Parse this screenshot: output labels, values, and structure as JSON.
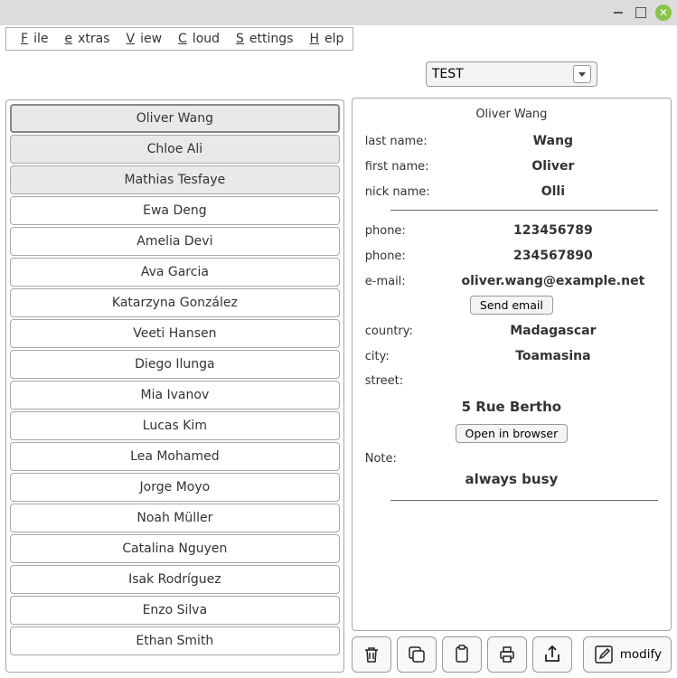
{
  "menu": {
    "file": "File",
    "extras": "extras",
    "view": "View",
    "cloud": "Cloud",
    "settings": "Settings",
    "help": "Help"
  },
  "dropdown": {
    "selected": "TEST"
  },
  "contacts": {
    "items": [
      {
        "name": "Oliver Wang",
        "selected": true,
        "focused": true
      },
      {
        "name": "Chloe Ali",
        "selected": true,
        "focused": false
      },
      {
        "name": "Mathias Tesfaye",
        "selected": true,
        "focused": false
      },
      {
        "name": "Ewa Deng",
        "selected": false,
        "focused": false
      },
      {
        "name": "Amelia Devi",
        "selected": false,
        "focused": false
      },
      {
        "name": "Ava Garcia",
        "selected": false,
        "focused": false
      },
      {
        "name": "Katarzyna González",
        "selected": false,
        "focused": false
      },
      {
        "name": "Veeti Hansen",
        "selected": false,
        "focused": false
      },
      {
        "name": "Diego Ilunga",
        "selected": false,
        "focused": false
      },
      {
        "name": "Mia Ivanov",
        "selected": false,
        "focused": false
      },
      {
        "name": "Lucas Kim",
        "selected": false,
        "focused": false
      },
      {
        "name": "Lea Mohamed",
        "selected": false,
        "focused": false
      },
      {
        "name": "Jorge Moyo",
        "selected": false,
        "focused": false
      },
      {
        "name": "Noah Müller",
        "selected": false,
        "focused": false
      },
      {
        "name": "Catalina Nguyen",
        "selected": false,
        "focused": false
      },
      {
        "name": "Isak Rodríguez",
        "selected": false,
        "focused": false
      },
      {
        "name": "Enzo Silva",
        "selected": false,
        "focused": false
      },
      {
        "name": "Ethan Smith",
        "selected": false,
        "focused": false
      }
    ]
  },
  "details": {
    "title": "Oliver Wang",
    "labels": {
      "last_name": "last name:",
      "first_name": "first name:",
      "nick_name": "nick name:",
      "phone1": "phone:",
      "phone2": "phone:",
      "email": "e-mail:",
      "country": "country:",
      "city": "city:",
      "street": "street:",
      "note": "Note:"
    },
    "values": {
      "last_name": "Wang",
      "first_name": "Oliver",
      "nick_name": "Olli",
      "phone1": "123456789",
      "phone2": "234567890",
      "email": "oliver.wang@example.net",
      "country": "Madagascar",
      "city": "Toamasina",
      "street": "5 Rue Bertho",
      "note": "always busy"
    },
    "buttons": {
      "send_email": "Send email",
      "open_browser": "Open in browser"
    }
  },
  "toolbar": {
    "modify": "modify"
  }
}
